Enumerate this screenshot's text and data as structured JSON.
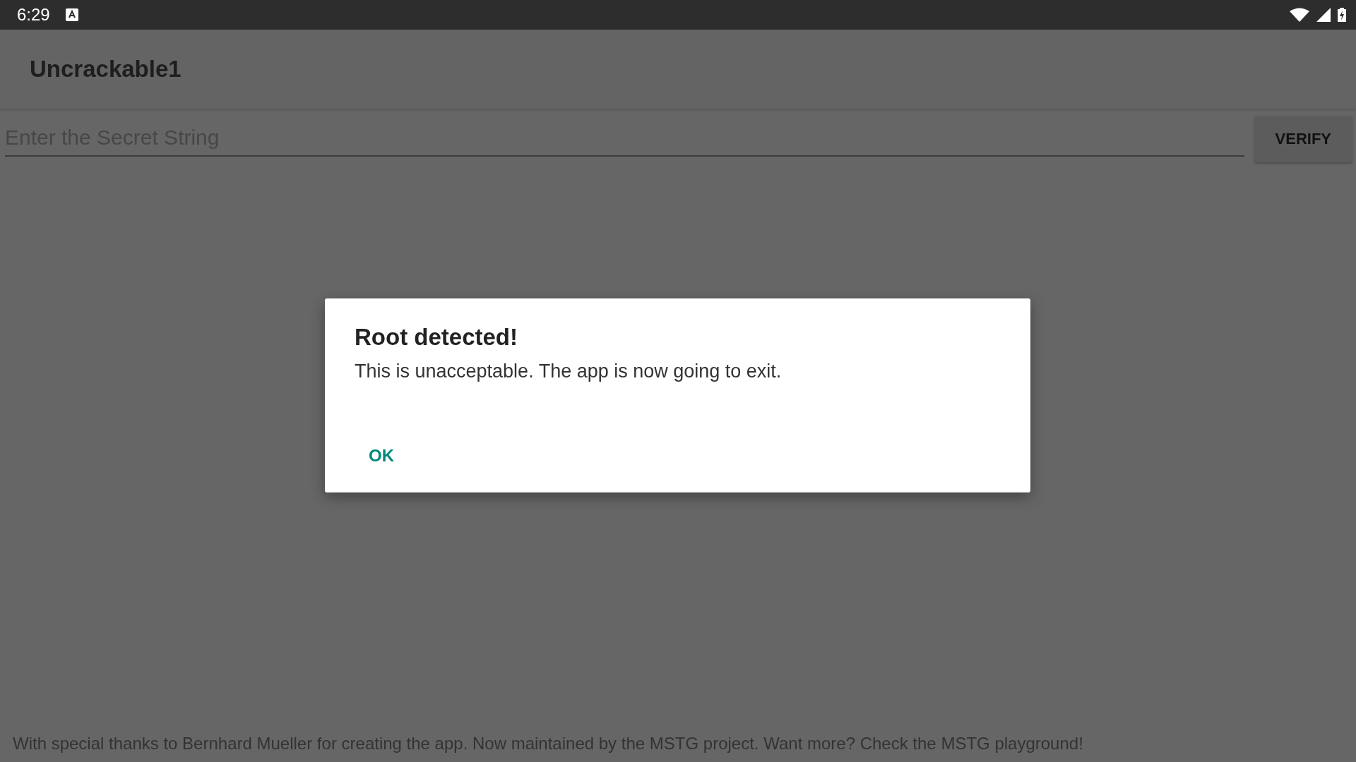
{
  "status_bar": {
    "time": "6:29"
  },
  "app_bar": {
    "title": "Uncrackable1"
  },
  "secret_field": {
    "placeholder": "Enter the Secret String"
  },
  "verify_button": "VERIFY",
  "footer": "With special thanks to Bernhard Mueller for creating the app. Now maintained by the MSTG project. Want more? Check the MSTG playground!",
  "dialog": {
    "title": "Root detected!",
    "message": "This is unacceptable. The app is now going to exit.",
    "buttons": [
      "OK"
    ]
  }
}
